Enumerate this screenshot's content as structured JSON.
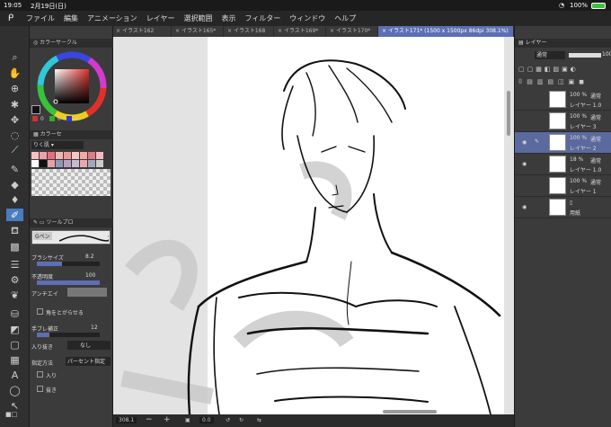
{
  "status": {
    "time": "19:05",
    "date": "2月19日(日)",
    "battery": "100%"
  },
  "menu": [
    "ファイル",
    "編集",
    "アニメーション",
    "レイヤー",
    "選択範囲",
    "表示",
    "フィルター",
    "ウィンドウ",
    "ヘルプ"
  ],
  "tabs": [
    {
      "label": "イラスト162"
    },
    {
      "label": "イラスト165*"
    },
    {
      "label": "イラスト168"
    },
    {
      "label": "イラスト169*"
    },
    {
      "label": "イラスト170*"
    },
    {
      "label": "イラスト171* (1500 x 1500px 86dpi 308.1%)",
      "active": true
    }
  ],
  "color_circle": {
    "title": "カラーサークル",
    "values": [
      "0",
      "0",
      "0"
    ]
  },
  "color_set": {
    "title": "カラーセ",
    "name": "りく肌"
  },
  "tool_property": {
    "title": "ツールプロ",
    "preset": "Gペン",
    "brush_size_label": "ブラシサイズ",
    "brush_size": "8.2",
    "opacity_label": "不透明度",
    "opacity": "100",
    "antialias_label": "アンチエイ",
    "sharpen_label": "角をとがらせる",
    "stabilizer_label": "手ブレ補正",
    "stabilizer": "12",
    "taper_label": "入り抜き",
    "taper_value": "なし",
    "method_label": "指定方法",
    "method_value": "パーセント指定",
    "in_label": "入り",
    "out_label": "抜き"
  },
  "layers_panel": {
    "title": "レイヤー",
    "blend": "通常",
    "opacity": "100",
    "layers": [
      {
        "pct": "100 %",
        "mode": "通常",
        "name": "レイヤー 1.0"
      },
      {
        "pct": "100 %",
        "mode": "通常",
        "name": "レイヤー 3"
      },
      {
        "pct": "100 %",
        "mode": "通常",
        "name": "レイヤー 2",
        "selected": true
      },
      {
        "pct": "18 %",
        "mode": "通常",
        "name": "レイヤー 1.0"
      },
      {
        "pct": "100 %",
        "mode": "通常",
        "name": "レイヤー 1"
      },
      {
        "pct": "",
        "mode": "",
        "name": "用紙"
      }
    ]
  },
  "bottom": {
    "zoom": "308.1",
    "angle": "0.0"
  },
  "colors": {
    "accent": "#5c6fb5",
    "tool_sel": "#4a7cc0",
    "layer_sel": "#5b6a9e"
  }
}
